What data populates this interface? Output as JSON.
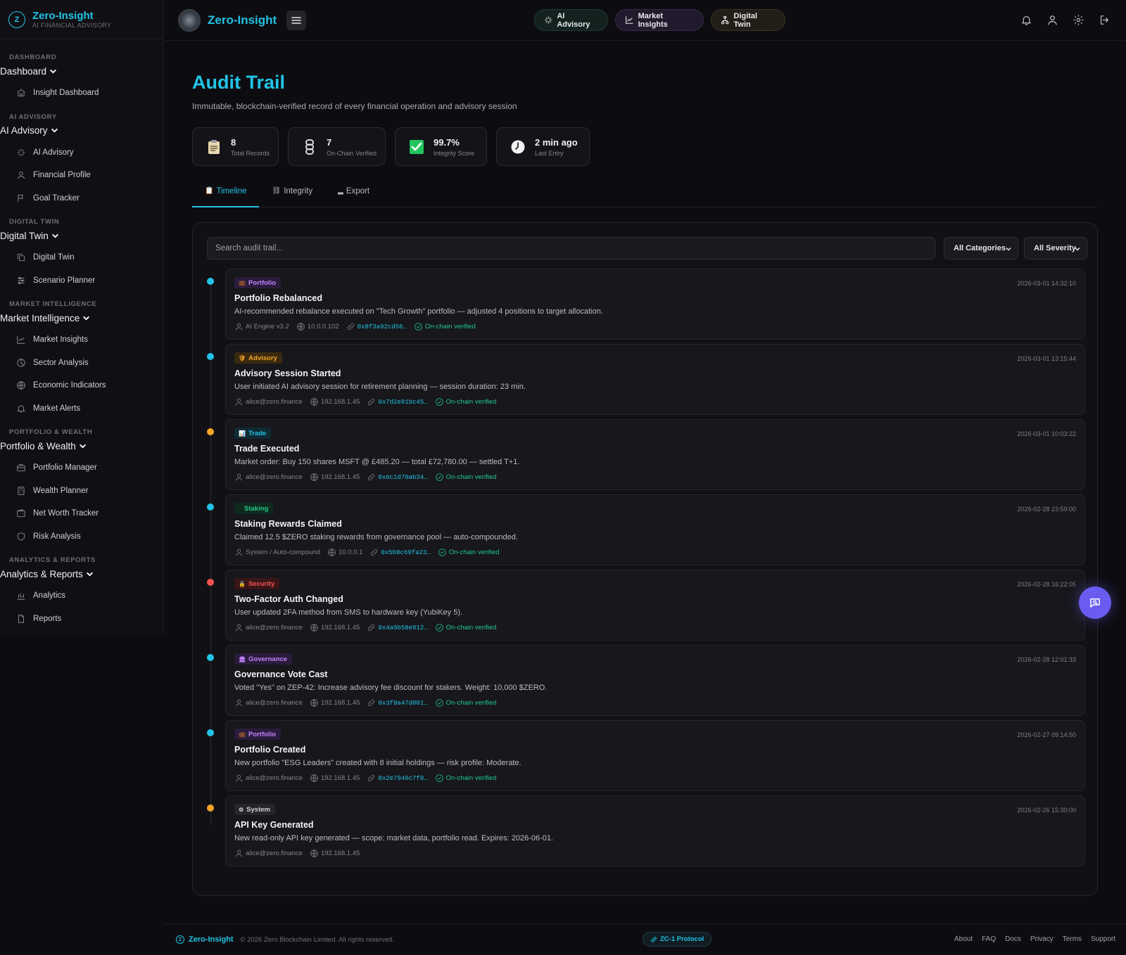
{
  "sidebar": {
    "brand_logo": "Z",
    "brand_name": "Zero-Insight",
    "brand_sub": "AI FINANCIAL ADVISORY",
    "sections": [
      {
        "label": "DASHBOARD",
        "title": "Dashboard",
        "items": [
          {
            "label": "Insight Dashboard",
            "icon": "home-icon"
          }
        ]
      },
      {
        "label": "AI ADVISORY",
        "title": "AI Advisory",
        "items": [
          {
            "label": "AI Advisory",
            "icon": "sparkles-icon"
          },
          {
            "label": "Financial Profile",
            "icon": "user-icon"
          },
          {
            "label": "Goal Tracker",
            "icon": "flag-icon"
          }
        ]
      },
      {
        "label": "DIGITAL TWIN",
        "title": "Digital Twin",
        "items": [
          {
            "label": "Digital Twin",
            "icon": "copy-icon"
          },
          {
            "label": "Scenario Planner",
            "icon": "sliders-icon"
          }
        ]
      },
      {
        "label": "MARKET INTELLIGENCE",
        "title": "Market Intelligence",
        "items": [
          {
            "label": "Market Insights",
            "icon": "chart-line-icon"
          },
          {
            "label": "Sector Analysis",
            "icon": "pie-icon"
          },
          {
            "label": "Economic Indicators",
            "icon": "globe-icon"
          },
          {
            "label": "Market Alerts",
            "icon": "bell-icon"
          }
        ]
      },
      {
        "label": "PORTFOLIO & WEALTH",
        "title": "Portfolio & Wealth",
        "items": [
          {
            "label": "Portfolio Manager",
            "icon": "briefcase-icon"
          },
          {
            "label": "Wealth Planner",
            "icon": "calculator-icon"
          },
          {
            "label": "Net Worth Tracker",
            "icon": "wallet-icon"
          },
          {
            "label": "Risk Analysis",
            "icon": "shield-icon"
          }
        ]
      },
      {
        "label": "ANALYTICS & REPORTS",
        "title": "Analytics & Reports",
        "items": [
          {
            "label": "Analytics",
            "icon": "bar-chart-icon"
          },
          {
            "label": "Reports",
            "icon": "file-icon"
          }
        ]
      }
    ]
  },
  "topbar": {
    "brand_name": "Zero-Insight",
    "pills": {
      "ai": "AI Advisory",
      "mi": "Market Insights",
      "dt": "Digital Twin"
    }
  },
  "page": {
    "title": "Audit Trail",
    "subtitle": "Immutable, blockchain-verified record of every financial operation and advisory session"
  },
  "stats": [
    {
      "value": "8",
      "label": "Total Records",
      "icon": "clipboard-icon"
    },
    {
      "value": "7",
      "label": "On-Chain Verified",
      "icon": "chain-icon"
    },
    {
      "value": "99.7%",
      "label": "Integrity Score",
      "icon": "check-box-icon"
    },
    {
      "value": "2 min ago",
      "label": "Last Entry",
      "icon": "clock-icon"
    }
  ],
  "tabs": {
    "timeline": "Timeline",
    "integrity": "Integrity",
    "export": "Export"
  },
  "filters": {
    "search_placeholder": "Search audit trail...",
    "category": "All Categories",
    "severity": "All Severity"
  },
  "colors": {
    "accent": "#22c3e6",
    "verified": "#22c98a",
    "fab": "#6a5cf0"
  },
  "entries": [
    {
      "badge": "Portfolio",
      "title": "Portfolio Rebalanced",
      "timestamp": "2026-03-01 14:32:10",
      "desc": "AI-recommended rebalance executed on \"Tech Growth\" portfolio — adjusted 4 positions to target allocation.",
      "actor": "AI Engine v3.2",
      "ip": "10.0.0.102",
      "hash": "0x8f3a92cd56…",
      "verified": "On-chain verified"
    },
    {
      "badge": "Advisory",
      "title": "Advisory Session Started",
      "timestamp": "2026-03-01 13:15:44",
      "desc": "User initiated AI advisory session for retirement planning — session duration: 23 min.",
      "actor": "alice@zero.finance",
      "ip": "192.168.1.45",
      "hash": "0x7d2e81bc45…",
      "verified": "On-chain verified"
    },
    {
      "badge": "Trade",
      "title": "Trade Executed",
      "timestamp": "2026-03-01 10:03:22",
      "desc": "Market order: Buy 150 shares MSFT @ £485.20 — total £72,780.00 — settled T+1.",
      "actor": "alice@zero.finance",
      "ip": "192.168.1.45",
      "hash": "0x6c1d70ab34…",
      "verified": "On-chain verified"
    },
    {
      "badge": "Staking",
      "title": "Staking Rewards Claimed",
      "timestamp": "2026-02-28 23:59:00",
      "desc": "Claimed 12.5 $ZERO staking rewards from governance pool — auto-compounded.",
      "actor": "System / Auto-compound",
      "ip": "10.0.0.1",
      "hash": "0x5b0c69fa23…",
      "verified": "On-chain verified"
    },
    {
      "badge": "Security",
      "title": "Two-Factor Auth Changed",
      "timestamp": "2026-02-28 16:22:05",
      "desc": "User updated 2FA method from SMS to hardware key (YubiKey 5).",
      "actor": "alice@zero.finance",
      "ip": "192.168.1.45",
      "hash": "0x4a9b58e912…",
      "verified": "On-chain verified"
    },
    {
      "badge": "Governance",
      "title": "Governance Vote Cast",
      "timestamp": "2026-02-28 12:01:33",
      "desc": "Voted \"Yes\" on ZEP-42: Increase advisory fee discount for stakers. Weight: 10,000 $ZERO.",
      "actor": "alice@zero.finance",
      "ip": "192.168.1.45",
      "hash": "0x3f8a47d801…",
      "verified": "On-chain verified"
    },
    {
      "badge": "Portfolio",
      "title": "Portfolio Created",
      "timestamp": "2026-02-27 09:14:50",
      "desc": "New portfolio \"ESG Leaders\" created with 8 initial holdings — risk profile: Moderate.",
      "actor": "alice@zero.finance",
      "ip": "192.168.1.45",
      "hash": "0x2e7946c7f0…",
      "verified": "On-chain verified"
    },
    {
      "badge": "System",
      "title": "API Key Generated",
      "timestamp": "2026-02-26 15:30:00",
      "desc": "New read-only API key generated — scope: market data, portfolio read. Expires: 2026-06-01.",
      "actor": "alice@zero.finance",
      "ip": "192.168.1.45"
    }
  ],
  "footer": {
    "logo": "Z",
    "brand": "Zero-Insight",
    "copyright": "© 2026 Zero Blockchain Limited. All rights reserved.",
    "protocol": "ZC-1 Protocol",
    "links": [
      "About",
      "FAQ",
      "Docs",
      "Privacy",
      "Terms",
      "Support"
    ]
  }
}
